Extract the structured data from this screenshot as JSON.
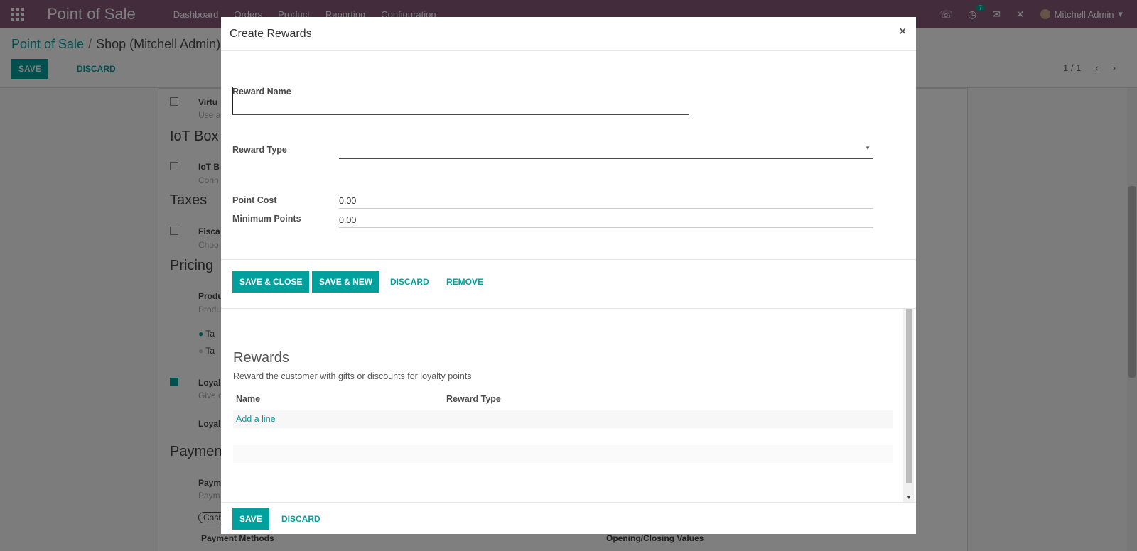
{
  "navbar": {
    "brand": "Point of Sale",
    "menu": [
      "Dashboard",
      "Orders",
      "Product",
      "Reporting",
      "Configuration"
    ],
    "activity_count": "7",
    "user_name": "Mitchell Admin"
  },
  "control_panel": {
    "breadcrumb_parent": "Point of Sale",
    "breadcrumb_current": "Shop (Mitchell Admin)",
    "save_label": "SAVE",
    "discard_label": "DISCARD",
    "pager": "1 / 1"
  },
  "background": {
    "virtual_title": "Virtu",
    "virtual_desc": "Use a",
    "iot_section": "IoT Box",
    "iot_title": "IoT B",
    "iot_desc": "Conn",
    "taxes_section": "Taxes",
    "fiscal_title": "Fisca",
    "fiscal_desc": "Choo",
    "pricing_section": "Pricing",
    "product_title": "Produ",
    "product_desc": "Produ",
    "radio1": "Ta",
    "radio2": "Ta",
    "loyalty_title": "Loyal",
    "loyalty_desc": "Give c",
    "loyalty2": "Loyal",
    "payment_section": "Payment",
    "payment_title": "Paym",
    "payment_desc": "Paym",
    "cash_tag": "Cash",
    "payment_methods": "Payment Methods",
    "opening_closing": "Opening/Closing Values"
  },
  "modal": {
    "title": "Create Rewards",
    "reward_name_label": "Reward Name",
    "reward_name_value": "",
    "reward_type_label": "Reward Type",
    "reward_type_value": "",
    "point_cost_label": "Point Cost",
    "point_cost_value": "0.00",
    "minimum_points_label": "Minimum Points",
    "minimum_points_value": "0.00",
    "save_close_label": "SAVE & CLOSE",
    "save_new_label": "SAVE & NEW",
    "discard_label": "DISCARD",
    "remove_label": "REMOVE",
    "rewards_title": "Rewards",
    "rewards_desc": "Reward the customer with gifts or discounts for loyalty points",
    "columns": [
      "Name",
      "Reward Type"
    ],
    "add_line": "Add a line",
    "footer_save": "SAVE",
    "footer_discard": "DISCARD"
  },
  "colors": {
    "navbar": "#875a7b",
    "primary": "#00a09d"
  }
}
